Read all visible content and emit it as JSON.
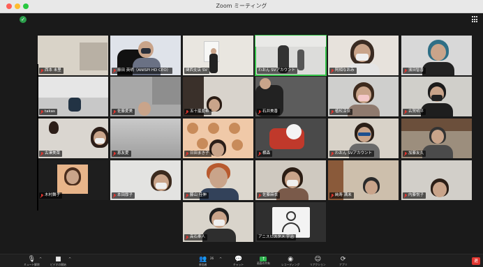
{
  "window": {
    "title": "Zoom ミーティング"
  },
  "participants": [
    {
      "name": "西本 未里",
      "muted": true
    },
    {
      "name": "藤田 英明（ANISPI HD CEO）",
      "muted": true
    },
    {
      "name": "関西支店 SV",
      "muted": false
    },
    {
      "name": "わおん SVアカウント",
      "muted": false,
      "active": true
    },
    {
      "name": "阿相なおみ",
      "muted": true
    },
    {
      "name": "濱田智香",
      "muted": true
    },
    {
      "name": "takas",
      "muted": true
    },
    {
      "name": "佐藤愛美",
      "muted": true
    },
    {
      "name": "五十嵐亜希",
      "muted": true
    },
    {
      "name": "石井美香",
      "muted": true
    },
    {
      "name": "植松涼奈",
      "muted": true
    },
    {
      "name": "古賀明平",
      "muted": true
    },
    {
      "name": "古澤美菜",
      "muted": true
    },
    {
      "name": "恵友愛",
      "muted": true
    },
    {
      "name": "日田まき子",
      "muted": true
    },
    {
      "name": "横森",
      "muted": true
    },
    {
      "name": "わおん SVアカウント",
      "muted": true
    },
    {
      "name": "加藤友久",
      "muted": true
    },
    {
      "name": "木村舞子",
      "muted": true
    },
    {
      "name": "本田厚子",
      "muted": true
    },
    {
      "name": "藤山 佳伸",
      "muted": true
    },
    {
      "name": "佐藤麻衣",
      "muted": true
    },
    {
      "name": "純寿 满未",
      "muted": true
    },
    {
      "name": "内藤悦子",
      "muted": true
    },
    {
      "name": "高石奉人",
      "muted": true
    },
    {
      "name": "アニスピスタメ 宇治",
      "muted": false
    }
  ],
  "toolbar": {
    "mute_label": "ミュート解除",
    "video_label": "ビデオの開始",
    "participants_label": "参加者",
    "participants_count": "26",
    "chat_label": "チャット",
    "share_label": "画面の共有",
    "record_label": "レコーディング",
    "reactions_label": "リアクション",
    "apps_label": "アプリ",
    "end_label": "退"
  },
  "icons": {
    "mic": "mic-muted-icon",
    "video": "video-off-icon",
    "participants": "participants-icon",
    "chat": "chat-icon",
    "share": "share-screen-icon",
    "record": "record-icon",
    "reactions": "reactions-icon",
    "apps": "apps-icon",
    "security": "shield-icon",
    "view": "gallery-view-icon"
  },
  "colors": {
    "accent_green": "#35c34a",
    "muted_red": "#e0352f",
    "end_red": "#e0352f"
  }
}
